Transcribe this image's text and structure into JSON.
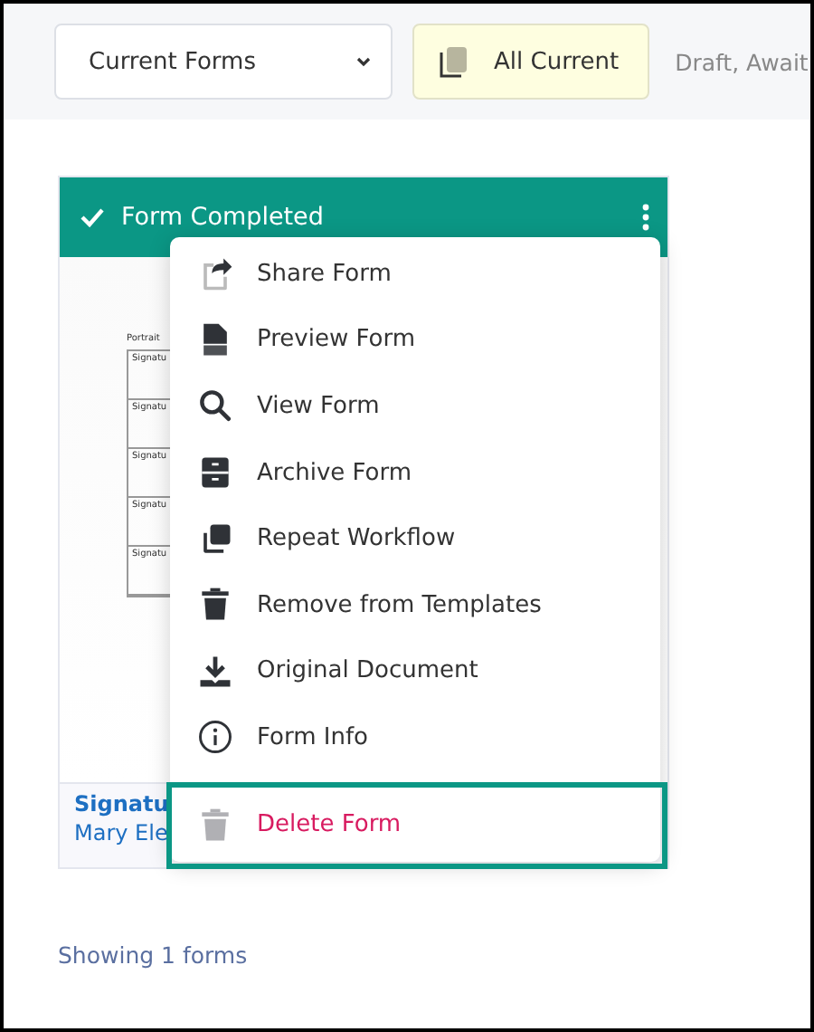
{
  "toolbar": {
    "view_select": {
      "value": "Current Forms"
    },
    "filter_button": {
      "label": "All Current",
      "selected": true
    },
    "filter_hint": "Draft, Await"
  },
  "card": {
    "status": "Form Completed",
    "thumbnail": {
      "heading": "Portrait",
      "rows": [
        "Signatu",
        "Signatu",
        "Signatu",
        "Signatu",
        "Signatu"
      ]
    },
    "title": "Signatu",
    "owner": "Mary Ele"
  },
  "menu": {
    "items": [
      {
        "label": "Share Form",
        "highlighted": false,
        "danger": false
      },
      {
        "label": "Preview Form",
        "highlighted": false,
        "danger": false
      },
      {
        "label": "View Form",
        "highlighted": false,
        "danger": false
      },
      {
        "label": "Archive Form",
        "highlighted": false,
        "danger": false
      },
      {
        "label": "Repeat Workflow",
        "highlighted": false,
        "danger": false
      },
      {
        "label": "Remove from Templates",
        "highlighted": false,
        "danger": false
      },
      {
        "label": "Original Document",
        "highlighted": false,
        "danger": false
      },
      {
        "label": "Form Info",
        "highlighted": false,
        "danger": false
      },
      {
        "label": "Delete Form",
        "highlighted": true,
        "danger": true
      }
    ]
  },
  "footer": "Showing 1 forms"
}
